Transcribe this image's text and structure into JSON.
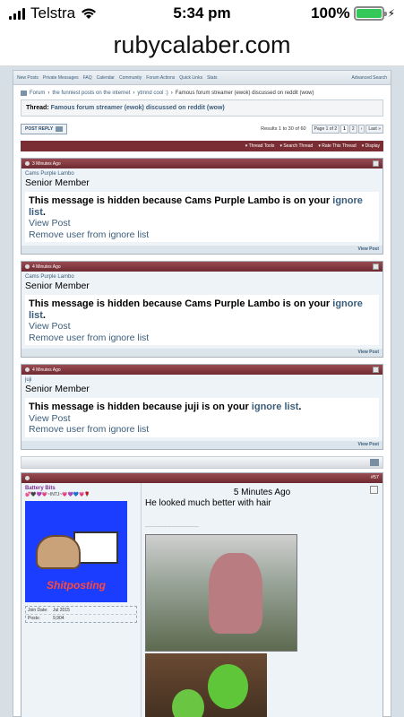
{
  "status": {
    "carrier": "Telstra",
    "time": "5:34 pm",
    "battery": "100%"
  },
  "browser": {
    "url": "rubycalaber.com"
  },
  "navbar": {
    "items": [
      "New Posts",
      "Private Messages",
      "FAQ",
      "Calendar",
      "Community",
      "Forum Actions",
      "Quick Links",
      "Stats"
    ],
    "advanced": "Advanced Search"
  },
  "breadcrumb": {
    "forum": "Forum",
    "section": "the funniest posts on the internet",
    "sub": "ytmnd cool :)",
    "current": "Famous forum streamer (ewok) discussed on reddit (wow)"
  },
  "thread": {
    "label": "Thread:",
    "title": "Famous forum streamer (ewok) discussed on reddit (wow)"
  },
  "actions": {
    "post_reply": "POST REPLY",
    "results": "Results 1 to 30 of 60",
    "pages": [
      "Page 1 of 2",
      "1",
      "2",
      "›",
      "Last »"
    ]
  },
  "tools": [
    "Thread Tools",
    "Search Thread",
    "Rate This Thread",
    "Display"
  ],
  "hidden_posts": [
    {
      "time": "3 Minutes Ago",
      "user": "Cams Purple Lambo",
      "title": "Senior Member",
      "msg_pre": "This message is hidden because Cams Purple Lambo is on your ",
      "msg_link": "ignore list",
      "msg_post": ".",
      "view": "View Post",
      "remove": "Remove user from ignore list",
      "footer": "View Post"
    },
    {
      "time": "4 Minutes Ago",
      "user": "Cams Purple Lambo",
      "title": "Senior Member",
      "msg_pre": "This message is hidden because Cams Purple Lambo is on your ",
      "msg_link": "ignore list",
      "msg_post": ".",
      "view": "View Post",
      "remove": "Remove user from ignore list",
      "footer": "View Post"
    },
    {
      "time": "4 Minutes Ago",
      "user": "juji",
      "title": "Senior Member",
      "msg_pre": "This message is hidden because juji is on your ",
      "msg_link": "ignore list",
      "msg_post": ".",
      "view": "View Post",
      "remove": "Remove user from ignore list",
      "footer": "View Post"
    }
  ],
  "post": {
    "number": "#57",
    "user": "Battery Bits",
    "tagline": "💕🖤💜💗~INTJ~💗💜💙💗🌹",
    "avatar_text": "Shitposting",
    "join_label": "Join Date:",
    "join_value": "Jul 2015",
    "posts_label": "Posts:",
    "posts_value": "9,904",
    "time": "5 Minutes Ago",
    "text": "He looked much better with hair",
    "sig": "------------------------------------"
  }
}
